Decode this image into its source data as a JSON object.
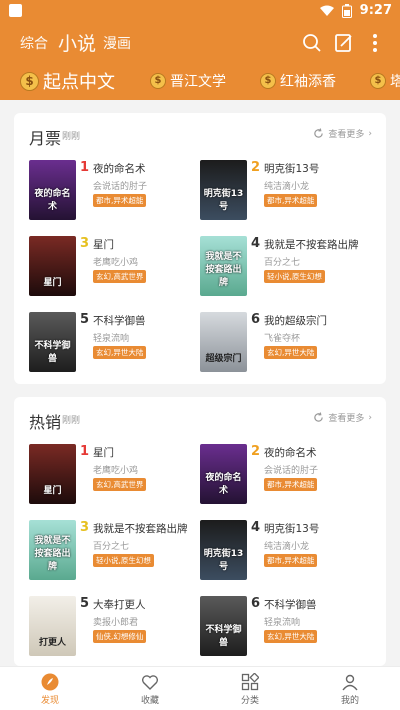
{
  "status": {
    "time": "9:27"
  },
  "nav": {
    "tabs": [
      {
        "label": "综合",
        "active": false
      },
      {
        "label": "小说",
        "active": true
      },
      {
        "label": "漫画",
        "active": false
      }
    ]
  },
  "sources": [
    "起点中文",
    "晋江文学",
    "红袖添香",
    "塔"
  ],
  "sections": [
    {
      "title": "月票",
      "subtitle": "刚刚",
      "more": "查看更多",
      "books": [
        {
          "rank": "1",
          "title": "夜的命名术",
          "author": "会说话的肘子",
          "tag": "都市,异术超能",
          "cover_text": "夜的命名术",
          "cover_color": "#3a2060"
        },
        {
          "rank": "2",
          "title": "明克街13号",
          "author": "纯洁滴小龙",
          "tag": "都市,异术超能",
          "cover_text": "明克街13号",
          "cover_color": "#222a35"
        },
        {
          "rank": "3",
          "title": "星门",
          "author": "老鹰吃小鸡",
          "tag": "玄幻,高武世界",
          "cover_text": "星门",
          "cover_color": "#4a1a1a"
        },
        {
          "rank": "4",
          "title": "我就是不按套路出牌",
          "author": "百分之七",
          "tag": "轻小说,原生幻想",
          "cover_text": "我就是不按套路出牌",
          "cover_color": "#7cc4c0"
        },
        {
          "rank": "5",
          "title": "不科学御兽",
          "author": "轻泉流响",
          "tag": "玄幻,异世大陆",
          "cover_text": "不科学御兽",
          "cover_color": "#3a3a3a"
        },
        {
          "rank": "6",
          "title": "我的超级宗门",
          "author": "飞雀夺杯",
          "tag": "玄幻,异世大陆",
          "cover_text": "超级宗门",
          "cover_color": "#b7bcc2"
        }
      ]
    },
    {
      "title": "热销",
      "subtitle": "刚刚",
      "more": "查看更多",
      "books": [
        {
          "rank": "1",
          "title": "星门",
          "author": "老鹰吃小鸡",
          "tag": "玄幻,高武世界",
          "cover_text": "星门",
          "cover_color": "#4a1a1a"
        },
        {
          "rank": "2",
          "title": "夜的命名术",
          "author": "会说话的肘子",
          "tag": "都市,异术超能",
          "cover_text": "夜的命名术",
          "cover_color": "#3a2060"
        },
        {
          "rank": "3",
          "title": "我就是不按套路出牌",
          "author": "百分之七",
          "tag": "轻小说,原生幻想",
          "cover_text": "我就是不按套路出牌",
          "cover_color": "#7cc4c0"
        },
        {
          "rank": "4",
          "title": "明克街13号",
          "author": "纯洁滴小龙",
          "tag": "都市,异术超能",
          "cover_text": "明克街13号",
          "cover_color": "#222a35"
        },
        {
          "rank": "5",
          "title": "大奉打更人",
          "author": "卖报小郎君",
          "tag": "仙侠,幻想修仙",
          "cover_text": "打更人",
          "cover_color": "#e8e4da"
        },
        {
          "rank": "6",
          "title": "不科学御兽",
          "author": "轻泉流响",
          "tag": "玄幻,异世大陆",
          "cover_text": "不科学御兽",
          "cover_color": "#3a3a3a"
        }
      ]
    }
  ],
  "tabbar": {
    "items": [
      {
        "label": "发现",
        "icon": "discover-icon",
        "active": true
      },
      {
        "label": "收藏",
        "icon": "heart-icon",
        "active": false
      },
      {
        "label": "分类",
        "icon": "category-icon",
        "active": false
      },
      {
        "label": "我的",
        "icon": "user-icon",
        "active": false
      }
    ]
  },
  "colors": {
    "accent": "#e98b33",
    "rank1": "#e53935",
    "rank2": "#f0a020",
    "rank3": "#e6c020",
    "rank_other": "#333333"
  }
}
